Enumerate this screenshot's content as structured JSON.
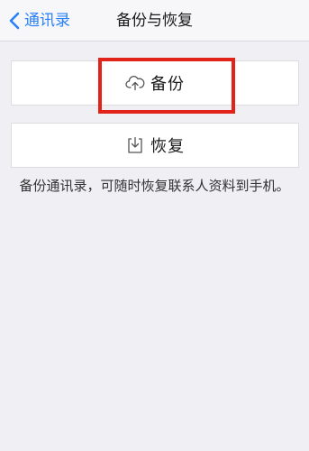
{
  "navbar": {
    "back_label": "通讯录",
    "back_icon": "chevron-left-icon",
    "title": "备份与恢复",
    "accent_color": "#2a80f7"
  },
  "buttons": {
    "backup": {
      "label": "备份",
      "icon": "cloud-upload-icon"
    },
    "restore": {
      "label": "恢复",
      "icon": "tray-download-icon"
    }
  },
  "highlight": {
    "color": "#e2231a",
    "target": "backup"
  },
  "description": "备份通讯录，可随时恢复联系人资料到手机。"
}
